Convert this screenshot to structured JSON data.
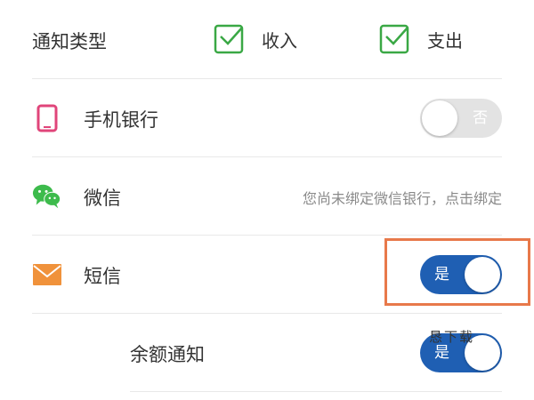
{
  "notify_type": {
    "label": "通知类型",
    "options": [
      {
        "label": "收入",
        "checked": true
      },
      {
        "label": "支出",
        "checked": true
      }
    ]
  },
  "rows": {
    "mobile_bank": {
      "label": "手机银行",
      "toggle": "否",
      "on": false,
      "icon": "phone-icon"
    },
    "wechat": {
      "label": "微信",
      "hint": "您尚未绑定微信银行，点击绑定",
      "icon": "wechat-icon"
    },
    "sms": {
      "label": "短信",
      "toggle": "是",
      "on": true,
      "icon": "mail-icon"
    },
    "balance": {
      "label": "余额通知",
      "toggle": "是",
      "on": true
    }
  },
  "watermark": "恳下载",
  "colors": {
    "check_green": "#3aa845",
    "toggle_on": "#1f5fb3",
    "toggle_off": "#e3e3e3",
    "highlight": "#e8794a",
    "phone_icon": "#e0457a",
    "wechat_icon": "#3dbb4c",
    "mail_icon": "#f0923b"
  }
}
